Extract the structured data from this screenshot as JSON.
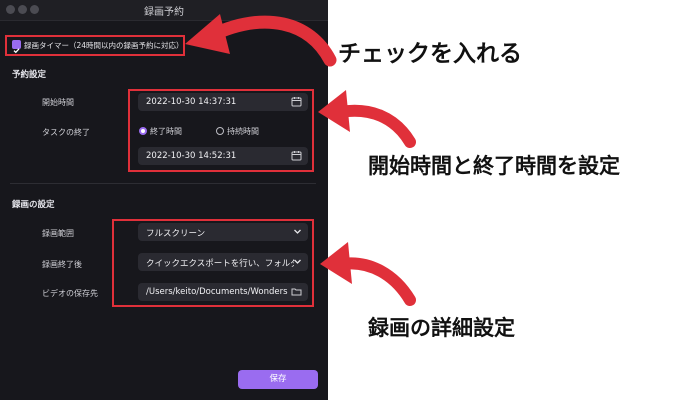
{
  "window": {
    "title": "録画予約"
  },
  "timer": {
    "checkbox_label": "録画タイマー（24時間以内の録画予約に対応）",
    "checked": true
  },
  "schedule": {
    "section_title": "予約設定",
    "start_label": "開始時間",
    "start_value": "2022-10-30 14:37:31",
    "end_label": "タスクの終了",
    "radio_end_time": "終了時間",
    "radio_duration": "持続時間",
    "selected": "終了時間",
    "end_value": "2022-10-30 14:52:31"
  },
  "recording": {
    "section_title": "録画の設定",
    "range_label": "録画範囲",
    "range_value": "フルスクリーン",
    "after_label": "録画終了後",
    "after_value": "クイックエクスポートを行い、フォルダ",
    "save_path_label": "ビデオの保存先",
    "save_path_value": "/Users/keito/Documents/Wonders"
  },
  "footer": {
    "save_label": "保存"
  },
  "annotations": {
    "check": "チェックを入れる",
    "times": "開始時間と終了時間を設定",
    "details": "録画の詳細設定"
  },
  "colors": {
    "accent": "#9a6cf0",
    "annotation_red": "#e0303a",
    "window_bg": "#17171c",
    "field_bg": "#2a2a31"
  },
  "icons": [
    "calendar-icon",
    "chevron-down-icon",
    "folder-icon",
    "checkbox-icon",
    "arrow-icon"
  ]
}
